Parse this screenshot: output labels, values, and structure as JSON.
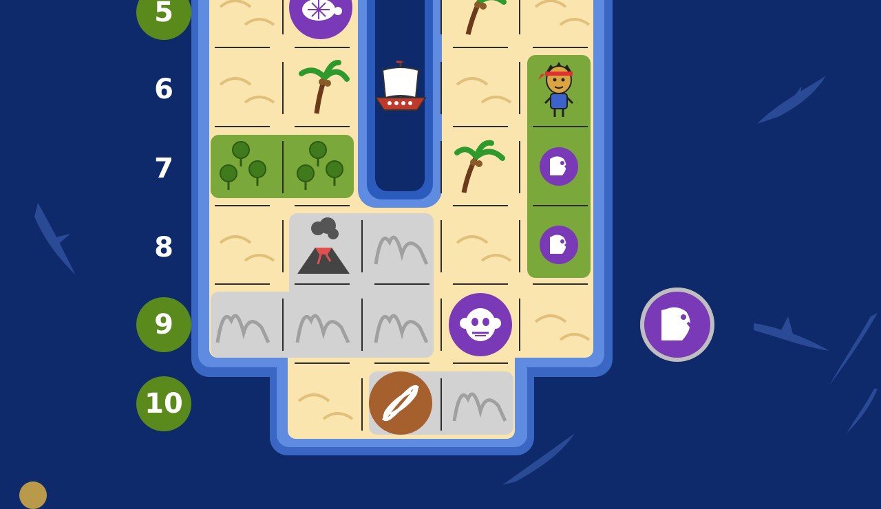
{
  "rows": [
    {
      "label": "5",
      "highlight": true
    },
    {
      "label": "6",
      "highlight": false
    },
    {
      "label": "7",
      "highlight": false
    },
    {
      "label": "8",
      "highlight": false
    },
    {
      "label": "9",
      "highlight": true
    },
    {
      "label": "10",
      "highlight": true
    }
  ],
  "colors": {
    "ocean": "#0f2a6b",
    "sand": "#fbe5ae",
    "rock": "#d2d2d2",
    "grass": "#7aa83a",
    "badge_purple": "#7a3ab8",
    "badge_brown": "#a6602e",
    "row_highlight": "#5a8a1c"
  },
  "icons": {
    "turtle": "turtle-icon",
    "palm": "palm-tree-icon",
    "ship": "sailing-ship-icon",
    "explorer": "explorer-character-icon",
    "parrot": "parrot-icon",
    "forest": "forest-icon",
    "volcano": "volcano-icon",
    "mountain": "mountain-icon",
    "monkey": "monkey-icon",
    "rope": "rope-knot-icon",
    "shark": "shark-icon",
    "beach": "dune-icon"
  }
}
